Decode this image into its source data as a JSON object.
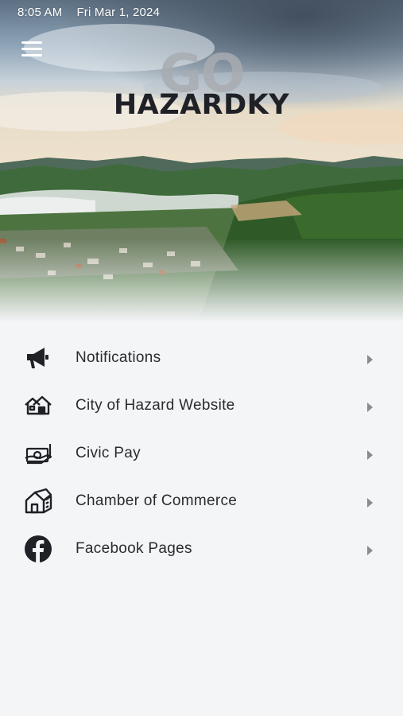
{
  "status_bar": {
    "time": "8:05 AM",
    "date": "Fri Mar 1, 2024"
  },
  "header": {
    "menu_icon": "hamburger-menu-icon",
    "logo_top": "GO",
    "logo_bottom": "HAZARDKY"
  },
  "menu": {
    "items": [
      {
        "label": "Notifications",
        "icon": "megaphone-icon"
      },
      {
        "label": "City of Hazard Website",
        "icon": "houses-icon"
      },
      {
        "label": "Civic Pay",
        "icon": "hand-money-icon"
      },
      {
        "label": "Chamber of Commerce",
        "icon": "building-icon"
      },
      {
        "label": "Facebook Pages",
        "icon": "facebook-icon"
      }
    ],
    "chevron_icon": "chevron-right-icon"
  },
  "colors": {
    "background": "#f4f5f7",
    "text": "#2a2b2e",
    "icon": "#1f2127",
    "chevron": "#8a8c90"
  }
}
